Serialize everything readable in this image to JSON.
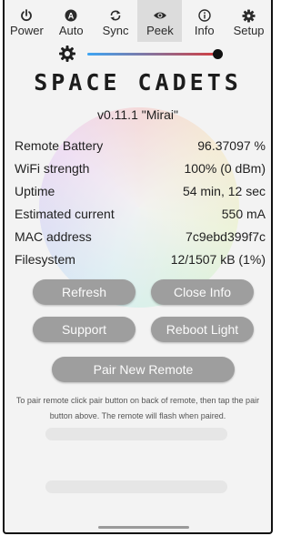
{
  "tabs": [
    {
      "label": "Power",
      "icon": "power-icon"
    },
    {
      "label": "Auto",
      "icon": "auto-icon"
    },
    {
      "label": "Sync",
      "icon": "sync-icon"
    },
    {
      "label": "Peek",
      "icon": "eye-icon",
      "active": true
    },
    {
      "label": "Info",
      "icon": "info-icon"
    },
    {
      "label": "Setup",
      "icon": "gear-icon"
    }
  ],
  "brightness": {
    "icon": "brightness-icon",
    "level": 0.97
  },
  "logo_text": "SPACE CADETS",
  "version": "v0.11.1 \"Mirai\"",
  "info_rows": [
    {
      "label": "Remote Battery",
      "value": "96.37097 %"
    },
    {
      "label": "WiFi strength",
      "value": "100% (0 dBm)"
    },
    {
      "label": "Uptime",
      "value": "54 min, 12 sec"
    },
    {
      "label": "Estimated current",
      "value": "550 mA"
    },
    {
      "label": "MAC address",
      "value": "7c9ebd399f7c"
    },
    {
      "label": "Filesystem",
      "value": "12/1507 kB (1%)"
    }
  ],
  "buttons": {
    "refresh": "Refresh",
    "close_info": "Close Info",
    "support": "Support",
    "reboot_light": "Reboot Light",
    "pair_new_remote": "Pair New Remote"
  },
  "pair_note": "To pair remote click pair button on back of remote, then tap the pair button above. The remote will flash when paired.",
  "colors": {
    "accent_track_start": "#3da5f4",
    "accent_track_end": "#d83a3a",
    "button": "#9e9e9e"
  }
}
